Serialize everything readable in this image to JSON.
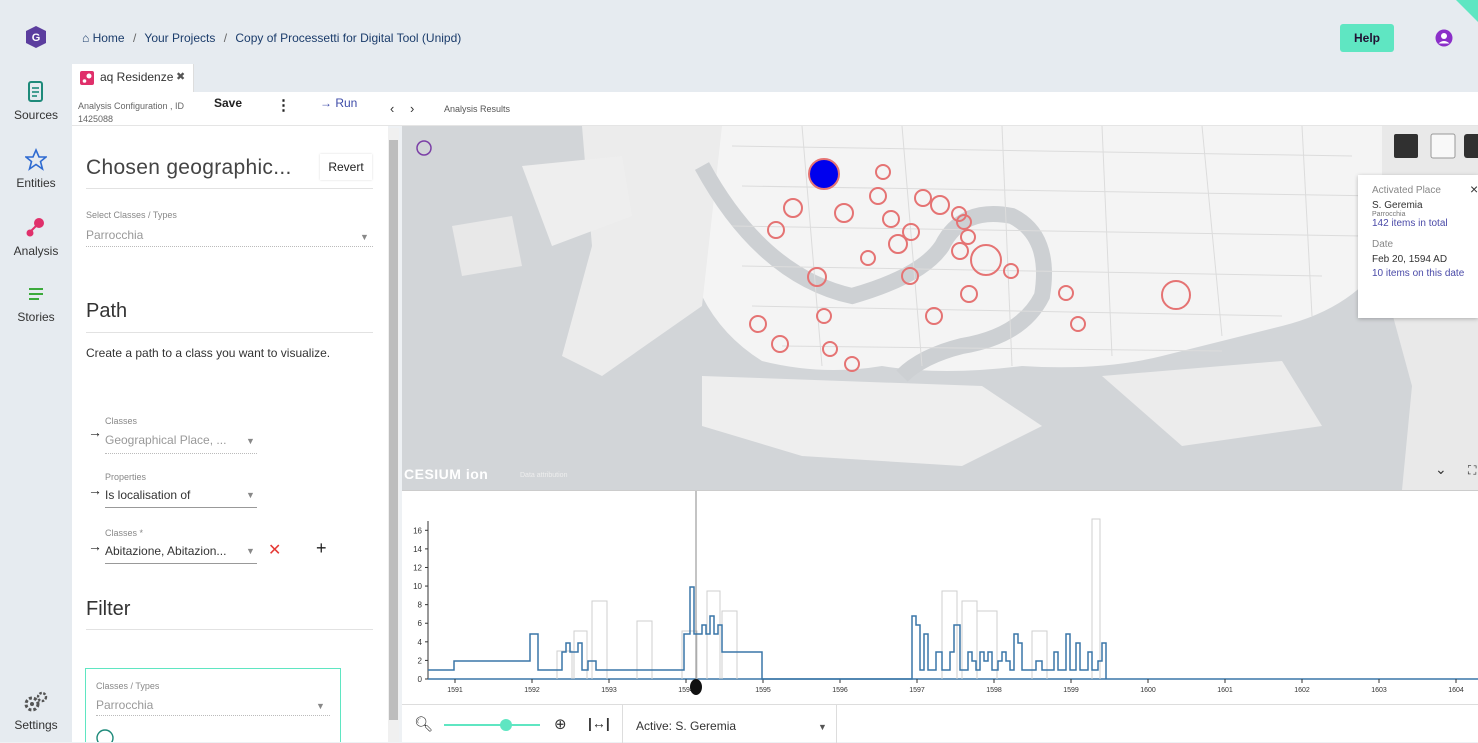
{
  "breadcrumb": {
    "home": "Home",
    "projects": "Your Projects",
    "current": "Copy of Processetti for Digital Tool (Unipd)"
  },
  "header": {
    "help_label": "Help"
  },
  "rail": [
    {
      "label": "Sources",
      "icon": "scroll-icon"
    },
    {
      "label": "Entities",
      "icon": "star-network-icon"
    },
    {
      "label": "Analysis",
      "icon": "analysis-icon"
    },
    {
      "label": "Stories",
      "icon": "list-icon"
    },
    {
      "label": "Settings",
      "icon": "gears-icon"
    }
  ],
  "tab": {
    "label": "aq Residenze",
    "close": "✖"
  },
  "toolbar": {
    "config_label": "Analysis Configuration , ID 1425088",
    "save_label": "Save",
    "more_label": "⋮",
    "run_label": "Run"
  },
  "geo_section": {
    "title": "Chosen geographic...",
    "revert_label": "Revert",
    "select_label": "Select Classes / Types",
    "select_value": "Parrocchia"
  },
  "path_section": {
    "title": "Path",
    "description": "Create a path to a class you want to visualize.",
    "rows": [
      {
        "label": "Classes",
        "value": "Geographical Place, ..."
      },
      {
        "label": "Properties",
        "value": "Is localisation of"
      },
      {
        "label": "Classes *",
        "value": "Abitazione, Abitazion..."
      }
    ],
    "remove_label": "✕",
    "add_label": "+"
  },
  "filter_section": {
    "title": "Filter",
    "select_label": "Classes / Types",
    "select_value": "Parrocchia"
  },
  "results": {
    "label": "Analysis Results"
  },
  "map": {
    "cesium_label": "CESIUM ion",
    "attribution": "Data attribution",
    "marker_color": "#e57373",
    "active_color": "#0000ee"
  },
  "popup": {
    "place_label": "Activated Place",
    "place_name": "S. Geremia",
    "place_type": "Parrocchia",
    "items_total": "142 items in total",
    "date_label": "Date",
    "date_value": "Feb 20, 1594 AD",
    "items_date": "10 items on this date",
    "close": "×"
  },
  "chart_data": {
    "type": "line",
    "y_ticks": [
      "0",
      "2",
      "4",
      "6",
      "8",
      "10",
      "12",
      "14",
      "16"
    ],
    "x_ticks": [
      "1591",
      "1592",
      "1593",
      "1594",
      "1595",
      "1596",
      "1597",
      "1598",
      "1599",
      "1600",
      "1601",
      "1602",
      "1603",
      "1604"
    ],
    "ylim": [
      0,
      17
    ],
    "series_color": "#3a76a8"
  },
  "bottom": {
    "active_label": "Active:",
    "active_value": "S. Geremia"
  }
}
